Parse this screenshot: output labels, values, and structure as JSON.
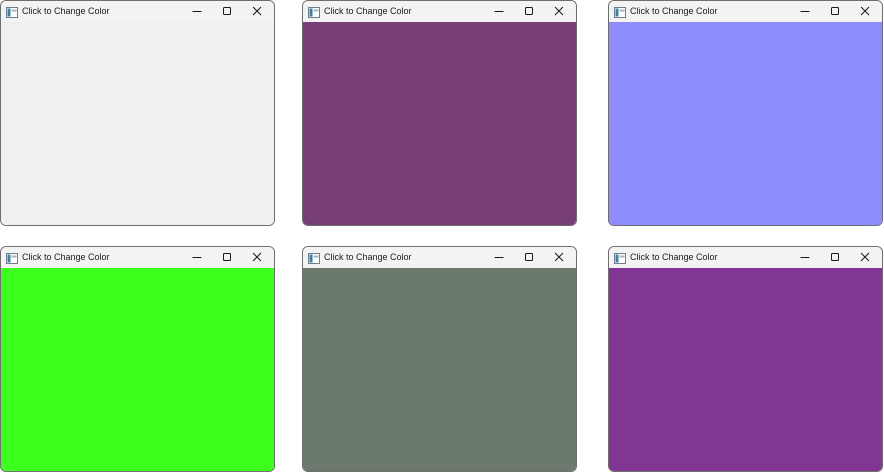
{
  "windows": [
    {
      "title": "Click to Change Color",
      "client_color": "#f0f0f0"
    },
    {
      "title": "Click to Change Color",
      "client_color": "#773e76"
    },
    {
      "title": "Click to Change Color",
      "client_color": "#8d8dff"
    },
    {
      "title": "Click to Change Color",
      "client_color": "#3cff1e"
    },
    {
      "title": "Click to Change Color",
      "client_color": "#6c7a6d"
    },
    {
      "title": "Click to Change Color",
      "client_color": "#823693"
    }
  ],
  "icons": {
    "app": "app-window-icon",
    "minimize": "minimize-icon",
    "maximize": "maximize-icon",
    "close": "close-icon"
  }
}
